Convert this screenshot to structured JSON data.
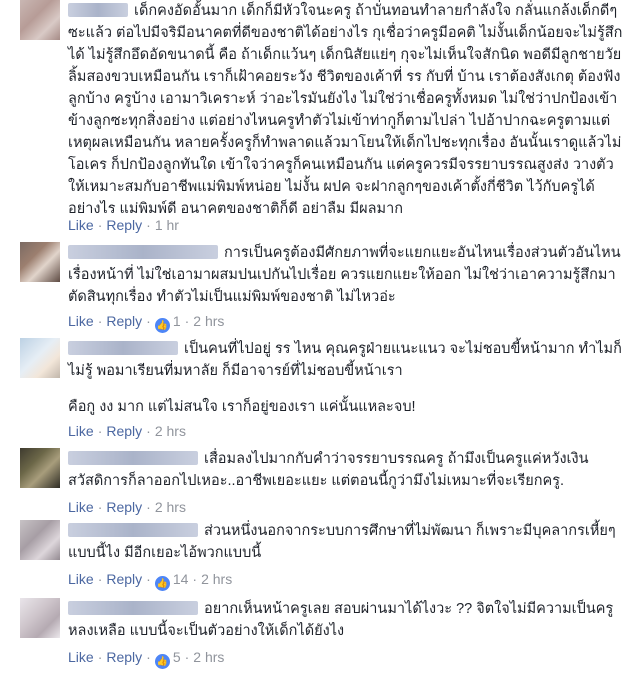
{
  "comments": [
    {
      "text": "เด็กคงอัดอั้นมาก เด็กก็มีหัวใจนะครู ถ้าบั่นทอนทำลายกำลังใจ กลั่นแกล้งเด็กดีๆซะแล้ว ต่อไปมีจริมีอนาคตที่ดีของชาติได้อย่างไร กุเชื่อว่าครูมีอคติ ไม่งั้นเด็กน้อยจะไม่รู้สึกได้ ไม่รู้สึกอึดอัดขนาดนี้ คือ ถ้าเด็กแว้นๆ เด็กนิสัยแย่ๆ กุจะไม่เห็นใจสักนิด พอดีมีลูกชายวัยลิ้มสองขวบเหมือนกัน เราก็เฝ้าคอยระวัง ชีวิตของเค้าที่ รร กับที่ บ้าน เราต้องสังเกตุ ต้องฟังลูกบ้าง ครูบ้าง เอามาวิเคราะห์ ว่าอะไรมันยังไง ไม่ใช่ว่าเชื่อครูทั้งหมด ไม่ใช่ว่าปกป้องเข้าข้างลูกซะทุกสิ่งอย่าง แต่อย่างไหนครูทำตัวไม่เข้าท่ากูก็ตามไปล่า ไปอ้าปากฉะครูตามแต่เหตุผลเหมือนกัน หลายครั้งครูก็ทำพลาดแล้วมาโยนให้เด็กไปชะทุกเรื่อง อันนั้นเราดูแล้วไม่โอเคร ก็ปกป้องลูกทันใด เข้าใจว่าครูก็คนเหมือนกัน แต่ครูควรมีจรรยาบรรณสูงส่ง วางตัวให้เหมาะสมกับอาชีพแม่พิมพ์หน่อย ไม่งั้น ผปค จะฝากลูกๆของเค้าตั้งกี่ชีวิต ไว้กับครูได้อย่างไร แม่พิมพ์ดี อนาคตของชาติก็ดี อย่าลืม มีผลมาก",
      "like": "Like",
      "reply": "Reply",
      "time": "1 hr",
      "reactions": ""
    },
    {
      "text": "การเป็นครูต้องมีศักยภาพที่จะแยกแยะอันไหนเรื่องส่วนตัวอันไหนเรื่องหน้าที่ ไม่ใช่เอามาผสมปนเปกันไปเรื่อย ควรแยกแยะให้ออก ไม่ใช่ว่าเอาความรู้สึกมาตัดสินทุกเรื่อง ทำตัวไม่เป็นแม่พิมพ์ของชาติ ไม่ไหวอ่ะ",
      "like": "Like",
      "reply": "Reply",
      "time": "2 hrs",
      "reactions": "1"
    },
    {
      "text": "เป็นคนที่ไปอยู่ รร ไหน คุณครูฝ่ายแนะแนว จะไม่ชอบขี้หน้ามาก ทำไมก็ไม่รู้ พอมาเรียนที่มหาลัย ก็มีอาจารย์ที่ไม่ชอบขี้หน้าเรา",
      "text2": "คือกู งง มาก แต่ไม่สนใจ เราก็อยู่ของเรา แค่นั้นแหละจบ!",
      "like": "Like",
      "reply": "Reply",
      "time": "2 hrs",
      "reactions": ""
    },
    {
      "text": "เสื่อมลงไปมากกับคำว่าจรรยาบรรณครู ถ้ามึงเป็นครูแค่หวังเงินสวัสดิการก็ลาออกไปเหอะ..อาชีพเยอะแยะ แต่ตอนนี้กูว่ามึงไม่เหมาะที่จะเรียกครู.",
      "like": "Like",
      "reply": "Reply",
      "time": "2 hrs",
      "reactions": ""
    },
    {
      "text": "ส่วนหนึ่งนอกจากระบบการศึกษาที่ไม่พัฒนา ก็เพราะมีบุคลากรเหี้ยๆแบบนี้ไง มีอีกเยอะไอ้พวกแบบนี้",
      "like": "Like",
      "reply": "Reply",
      "time": "2 hrs",
      "reactions": "14"
    },
    {
      "text": "อยากเห็นหน้าครูเลย สอบผ่านมาได้ไงวะ ?? จิตใจไม่มีความเป็นครูหลงเหลือ แบบนี้จะเป็นตัวอย่างให้เด็กได้ยังไง",
      "like": "Like",
      "reply": "Reply",
      "time": "2 hrs",
      "reactions": "5"
    }
  ],
  "colors": {
    "link": "#4b67a1",
    "meta": "#90949c",
    "text": "#1d2129",
    "like_badge": "#4e86f6"
  },
  "icons": {
    "reaction": "thumbs-up-icon"
  }
}
